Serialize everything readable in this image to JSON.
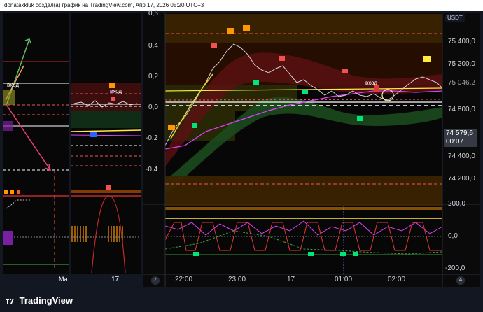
{
  "header": {
    "title": "donatakkluk создал(а) график на TradingView.com, Апр 17, 2026 05:20 UTC+3"
  },
  "footer": {
    "brand": "TradingView"
  },
  "left_panel": {
    "bottom_label": "Ma",
    "entry_label": "вход"
  },
  "mid_panel": {
    "bottom_label": "17",
    "entry_label": "вход"
  },
  "main": {
    "currency": "USDT",
    "entry_label": "вход",
    "left_axis": [
      "0,6",
      "0,4",
      "0,2",
      "0,0",
      "-0,2",
      "-0,4"
    ],
    "right_axis": [
      "75 400,0",
      "75 200,0",
      "74 800,0",
      "74 400,0",
      "74 200,0"
    ],
    "current_price": "75 046,2",
    "price_tag": "74 579,6",
    "price_timer": "00:07",
    "osc_axis": [
      "200,0",
      "0,0",
      "-200,0"
    ],
    "time_axis": [
      "22:00",
      "23:00",
      "17",
      "01:00",
      "02:00"
    ],
    "z_button": "Z",
    "a_button": "A"
  },
  "colors": {
    "up": "#26a69a",
    "down": "#ef5350",
    "band_red": "#8b1a1a",
    "band_green": "#1b5e20",
    "olive": "#6b6b10",
    "magenta": "#e040fb",
    "orange": "#ff9800",
    "yellow": "#ffeb3b"
  }
}
